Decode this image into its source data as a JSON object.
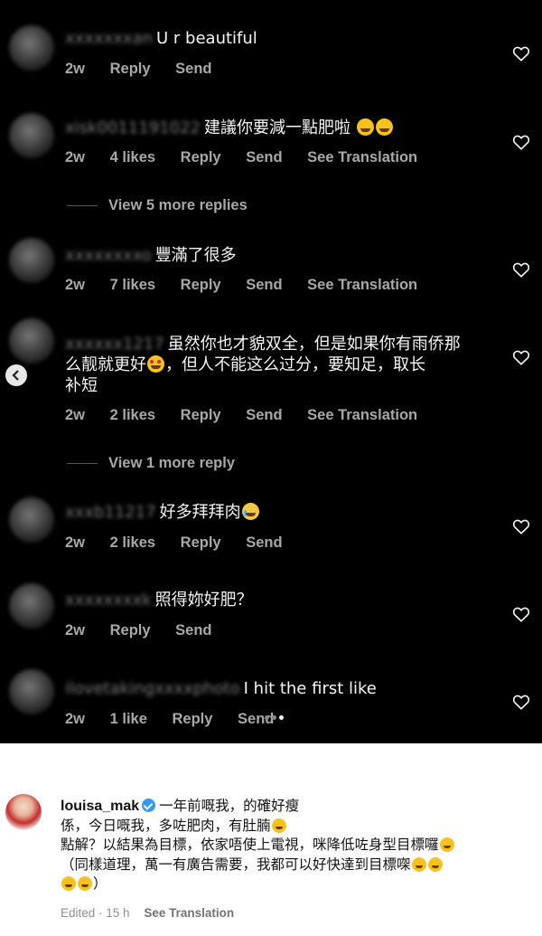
{
  "comments": [
    {
      "username": "xxxxxxxan",
      "text": "U r beautiful",
      "time": "2w",
      "likes": "",
      "reply": "Reply",
      "send": "Send",
      "translation": ""
    },
    {
      "username": "xisk0011191022",
      "text": "建議你要減一點肥啦",
      "emoji": "grin-grin",
      "time": "2w",
      "likes": "4 likes",
      "reply": "Reply",
      "send": "Send",
      "translation": "See Translation"
    },
    {
      "username": "xxxxxxxxo",
      "text": "豐滿了很多",
      "time": "2w",
      "likes": "7 likes",
      "reply": "Reply",
      "send": "Send",
      "translation": "See Translation"
    },
    {
      "username": "xxxxxx1217",
      "text_line1": "虽然你也才貌双全，但是如果你有雨侨那",
      "text_line2a": "么靓就更好",
      "text_line2b": "，但人不能这么过分，要知足，取长",
      "text_line3": "补短",
      "time": "2w",
      "likes": "2 likes",
      "reply": "Reply",
      "send": "Send",
      "translation": "See Translation"
    },
    {
      "username": "xxxb11217",
      "text": "好多拜拜肉",
      "time": "2w",
      "likes": "2 likes",
      "reply": "Reply",
      "send": "Send",
      "translation": ""
    },
    {
      "username": "xxxxxxxxk",
      "text": "照得妳好肥？",
      "time": "2w",
      "likes": "",
      "reply": "Reply",
      "send": "Send",
      "translation": ""
    },
    {
      "username": "ilovetakingxxxxphoto",
      "text": "I hit the first like",
      "time": "2w",
      "likes": "1 like",
      "reply": "Reply",
      "send": "Send",
      "translation": ""
    }
  ],
  "view_more": [
    "View 5 more replies",
    "View 1 more reply"
  ],
  "caption": {
    "username": "louisa_mak",
    "line1": "一年前嘅我，的確好瘦",
    "line2": "係，今日嘅我，多咗肥肉，有肚腩",
    "line3": "點解？以結果為目標，依家唔使上電視，咪降低咗身型目標囉",
    "line4": "（同樣道理，萬一有廣告需要，我都可以好快達到目標㗎",
    "line5": "）",
    "edited": "Edited · 15 h",
    "translation": "See Translation"
  },
  "icons": {
    "heart": "heart-outline-icon",
    "back": "chevron-left-icon",
    "verified": "verified-badge-icon"
  }
}
